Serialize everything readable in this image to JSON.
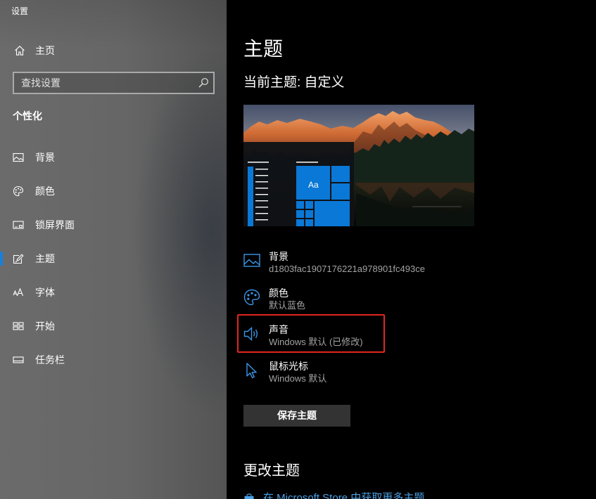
{
  "window": {
    "title": "设置"
  },
  "sidebar": {
    "home": {
      "label": "主页",
      "icon": "home-icon"
    },
    "search": {
      "placeholder": "查找设置",
      "icon": "search-icon"
    },
    "section_title": "个性化",
    "items": [
      {
        "label": "背景",
        "icon": "picture-icon",
        "selected": false
      },
      {
        "label": "颜色",
        "icon": "palette-icon",
        "selected": false
      },
      {
        "label": "锁屏界面",
        "icon": "lock-screen-icon",
        "selected": false
      },
      {
        "label": "主题",
        "icon": "theme-icon",
        "selected": true
      },
      {
        "label": "字体",
        "icon": "font-icon",
        "selected": false
      },
      {
        "label": "开始",
        "icon": "start-icon",
        "selected": false
      },
      {
        "label": "任务栏",
        "icon": "taskbar-icon",
        "selected": false
      }
    ]
  },
  "main": {
    "title": "主题",
    "current_theme": "当前主题: 自定义",
    "preview": {
      "tile_label": "Aa"
    },
    "theme_settings": [
      {
        "label": "背景",
        "value": "d1803fac1907176221a978901fc493ce",
        "icon": "picture-icon"
      },
      {
        "label": "颜色",
        "value": "默认蓝色",
        "icon": "palette-icon"
      },
      {
        "label": "声音",
        "value": "Windows 默认 (已修改)",
        "icon": "speaker-icon",
        "highlighted": true
      },
      {
        "label": "鼠标光标",
        "value": "Windows 默认",
        "icon": "cursor-icon"
      }
    ],
    "save_button": {
      "label": "保存主题"
    },
    "change_theme": {
      "heading": "更改主题",
      "store_link": "在 Microsoft Store 中获取更多主题",
      "store_icon": "store-icon"
    }
  },
  "colors": {
    "accent": "#0078d7",
    "icon_blue": "#3a95e8",
    "highlight_border": "#e0261f",
    "main_background": "#000000",
    "button_background": "#333333"
  }
}
